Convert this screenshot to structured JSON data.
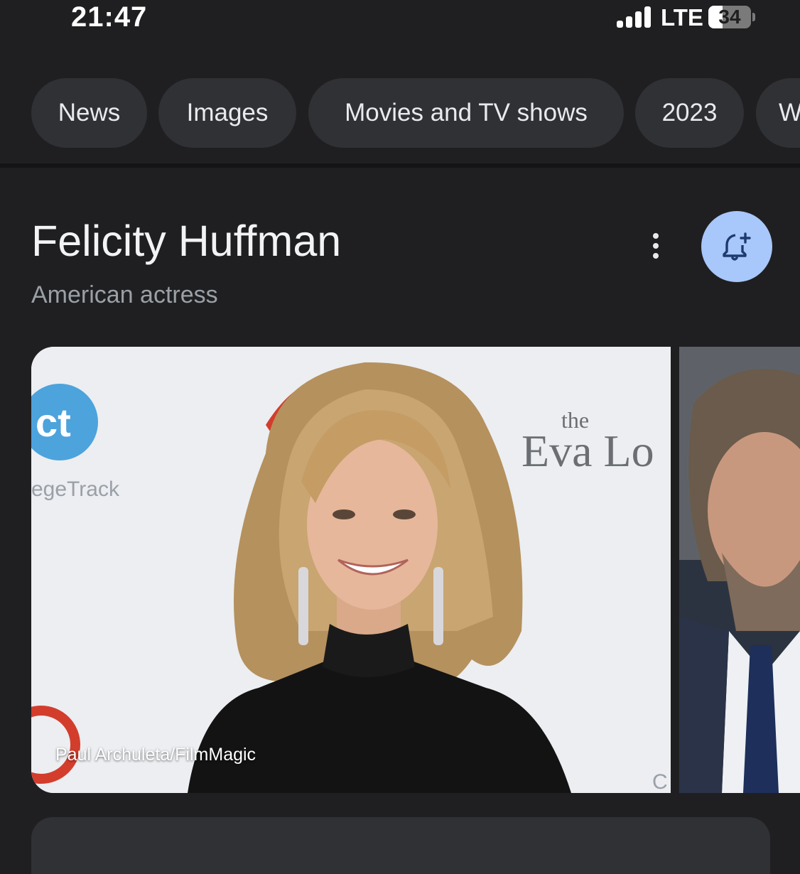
{
  "status_bar": {
    "time": "21:47",
    "network": "LTE",
    "battery": "34",
    "battery_level": 0.34
  },
  "chips": [
    {
      "label": "News"
    },
    {
      "label": "Images"
    },
    {
      "label": "Movies and TV shows"
    },
    {
      "label": "2023"
    },
    {
      "label": "W"
    }
  ],
  "entity": {
    "title": "Felicity Huffman",
    "subtitle": "American actress",
    "more_icon": "more-vert-icon",
    "follow_icon": "bell-plus-icon"
  },
  "photos": {
    "main_credit": "Paul Archuleta/FilmMagic",
    "backdrop_text_top": "the",
    "backdrop_text_main": "Eva Lo",
    "backdrop_logo_letters": "ct",
    "backdrop_logo_text": "egeTrack",
    "backdrop_corner": "C"
  },
  "colors": {
    "background": "#1f1f21",
    "chip": "#303134",
    "accent": "#a8c7fa"
  }
}
